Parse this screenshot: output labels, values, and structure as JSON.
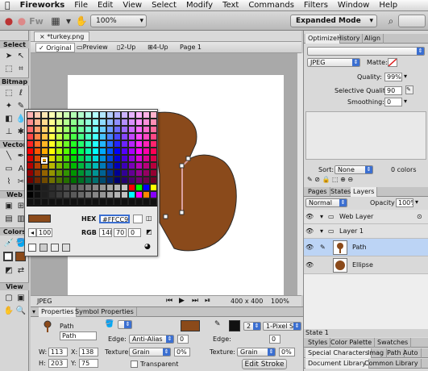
{
  "menubar": {
    "apple": "",
    "items": [
      "Fireworks",
      "File",
      "Edit",
      "View",
      "Select",
      "Modify",
      "Text",
      "Commands",
      "Filters",
      "Window",
      "Help"
    ]
  },
  "app_toolbar": {
    "logo": "Fw",
    "zoom": "100%",
    "workspace": "Expanded Mode"
  },
  "tools": {
    "sections": [
      "Select",
      "Bitmap",
      "Vector",
      "Web",
      "Colors",
      "View"
    ],
    "stroke_color": "#3b3b3b",
    "fill_color": "#8b4a1a"
  },
  "document": {
    "tab_title": "*turkey.png",
    "view_tabs": [
      "Original",
      "Preview",
      "2-Up",
      "4-Up"
    ],
    "page_name": "Page 1",
    "canvas_shape_color": "#8a4a1b"
  },
  "status": {
    "format": "JPEG",
    "size": "400 x 400",
    "zoom": "100%"
  },
  "color_popup": {
    "hex_label": "HEX",
    "hex_value": "#FFCC99",
    "rgb_label": "RGB",
    "r": "140",
    "g": "70",
    "b": "0",
    "opacity": "100",
    "current_color": "#8b4a1a"
  },
  "optimize_panel": {
    "tabs": [
      "Optimize",
      "History",
      "Align"
    ],
    "format": "JPEG",
    "matte_label": "Matte:",
    "quality_label": "Quality:",
    "quality": "99%",
    "selective_quality_label": "Selective Quality:",
    "selective_quality": "90",
    "smoothing_label": "Smoothing:",
    "smoothing": "0",
    "sort_label": "Sort:",
    "sort_value": "None",
    "colors_count": "0 colors"
  },
  "layers_panel": {
    "tabs": [
      "Pages",
      "States",
      "Layers"
    ],
    "blend": "Normal",
    "opacity_label": "Opacity",
    "opacity": "100%",
    "rows": [
      {
        "name": "Web Layer",
        "kind": "layer"
      },
      {
        "name": "Layer 1",
        "kind": "layer"
      },
      {
        "name": "Path",
        "kind": "object",
        "selected": true
      },
      {
        "name": "Ellipse",
        "kind": "object",
        "selected": false
      }
    ],
    "state": "State 1"
  },
  "bottom_right": {
    "tabs1": [
      "Styles",
      "Color Palette",
      "Swatches"
    ],
    "tabs2": [
      "Special Characters",
      "Imag",
      "Path",
      "Auto"
    ],
    "tabs3": [
      "Document Library",
      "Common Library"
    ]
  },
  "properties": {
    "tabs": [
      "Properties",
      "Symbol Properties"
    ],
    "object_type": "Path",
    "object_name": "Path",
    "w_label": "W:",
    "w": "113",
    "x_label": "X:",
    "x": "138",
    "h_label": "H:",
    "h": "203",
    "y_label": "Y:",
    "y": "75",
    "edge_label": "Edge:",
    "edge": "Anti-Alias",
    "edge_val": "0",
    "texture_label": "Texture:",
    "texture": "Grain",
    "texture_pct": "0%",
    "transparent_label": "Transparent",
    "stroke_size": "2",
    "stroke_type": "1-Pixel S...",
    "stroke_edge": "0",
    "stroke_texture": "Grain",
    "stroke_texture_pct": "0%",
    "edit_stroke": "Edit Stroke"
  }
}
